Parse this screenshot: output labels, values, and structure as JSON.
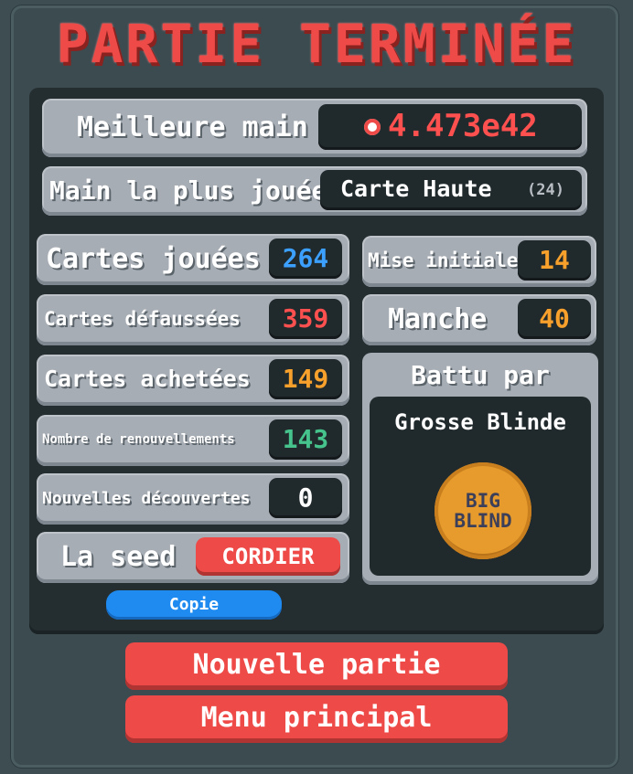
{
  "title": "PARTIE TERMINÉE",
  "best_hand": {
    "label": "Meilleure main",
    "icon": "chip-icon",
    "value": "4.473e42"
  },
  "most_played": {
    "label": "Main la plus jouée",
    "hand": "Carte Haute",
    "count": "(24)"
  },
  "stats": [
    {
      "label": "Cartes jouées",
      "value": "264",
      "color": "#3ba0ff"
    },
    {
      "label": "Cartes défaussées",
      "value": "359",
      "color": "#ff5050"
    },
    {
      "label": "Cartes achetées",
      "value": "149",
      "color": "#f7a02c"
    },
    {
      "label": "Nombre de renouvellements",
      "value": "143",
      "color": "#46c38c"
    },
    {
      "label": "Nouvelles découvertes",
      "value": "0",
      "color": "#ffffff"
    }
  ],
  "seed": {
    "label": "La seed",
    "value": "CORDIER",
    "copy_label": "Copie"
  },
  "side_stats": [
    {
      "label": "Mise initiale",
      "value": "14",
      "color": "#f7a02c"
    },
    {
      "label": "Manche",
      "value": "40",
      "color": "#f7a02c"
    }
  ],
  "defeated_by": {
    "label": "Battu par",
    "blind_name": "Grosse Blinde",
    "chip_line1": "BIG",
    "chip_line2": "BLIND"
  },
  "buttons": {
    "new_game": "Nouvelle partie",
    "main_menu": "Menu principal"
  }
}
